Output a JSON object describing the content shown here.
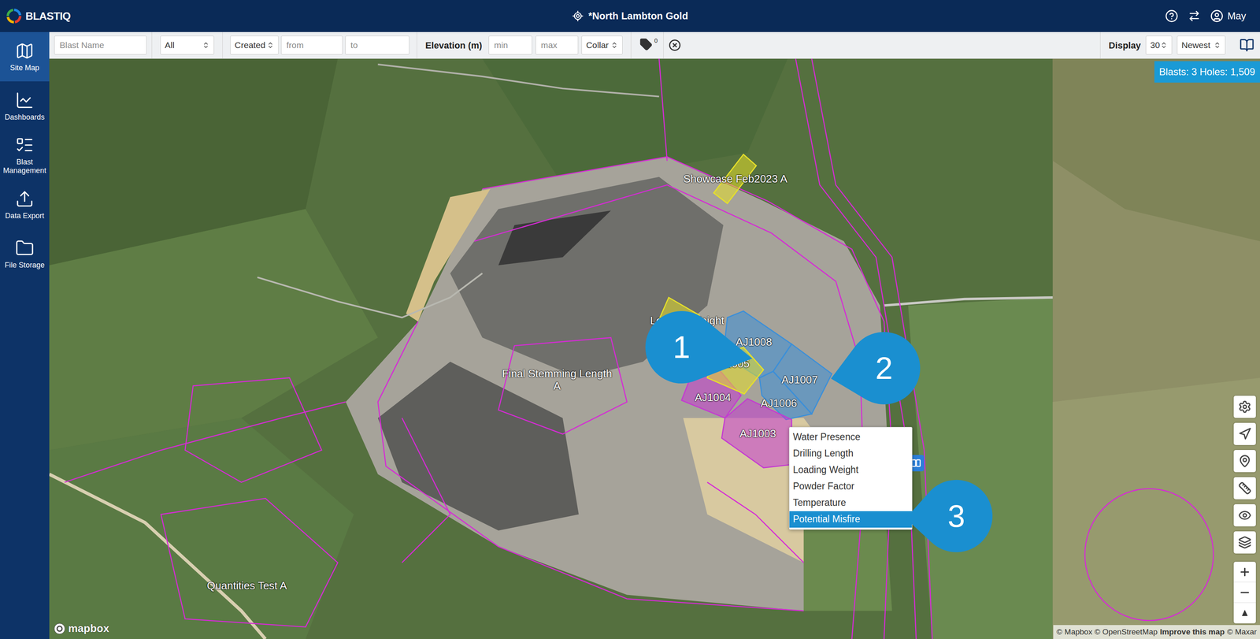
{
  "app": {
    "logo": "BLASTIQ",
    "site": "*North Lambton Gold",
    "user": "May"
  },
  "sidebar": {
    "items": [
      {
        "label": "Site Map",
        "selected": true
      },
      {
        "label": "Dashboards",
        "selected": false
      },
      {
        "label": "Blast Management",
        "selected": false
      },
      {
        "label": "Data Export",
        "selected": false
      },
      {
        "label": "File Storage",
        "selected": false
      }
    ]
  },
  "filters": {
    "blast_name": {
      "placeholder": "Blast Name"
    },
    "status": {
      "value": "All"
    },
    "date_field": {
      "value": "Created"
    },
    "from": {
      "placeholder": "from"
    },
    "to": {
      "placeholder": "to"
    },
    "elevation": {
      "label": "Elevation (m)",
      "min": {
        "placeholder": "min"
      },
      "max": {
        "placeholder": "max"
      },
      "reference": {
        "value": "Collar"
      }
    },
    "tags": {
      "count": "0"
    },
    "display": {
      "label": "Display",
      "count": "30",
      "sort": "Newest"
    }
  },
  "map": {
    "summary": "Blasts: 3 Holes: 1,509",
    "blasts": [
      {
        "label": "Showcase Feb2023 A",
        "color": "#e6e02a",
        "kind": "filled"
      },
      {
        "label": "Loading Weight",
        "color": "#e6e02a",
        "kind": "filled"
      },
      {
        "label": "AJ1008",
        "color": "#3b8fd9",
        "kind": "filled"
      },
      {
        "label": "AJ1005",
        "color": "#e6e02a",
        "kind": "filled"
      },
      {
        "label": "AJ1007",
        "color": "#3b8fd9",
        "kind": "filled"
      },
      {
        "label": "AJ1004",
        "color": "#c43bd1",
        "kind": "filled"
      },
      {
        "label": "AJ1006",
        "color": "#3b8fd9",
        "kind": "filled"
      },
      {
        "label": "AJ1003",
        "color": "#c43bd1",
        "kind": "filled"
      },
      {
        "label": "Final Stemming Length A",
        "color": "#d62ad6",
        "kind": "outline"
      },
      {
        "label": "Quantities Test A",
        "color": "#d62ad6",
        "kind": "outline"
      }
    ],
    "callouts": [
      {
        "label": "1"
      },
      {
        "label": "2"
      },
      {
        "label": "3"
      }
    ],
    "context_menu": {
      "items": [
        {
          "label": "Water Presence",
          "selected": false
        },
        {
          "label": "Drilling Length",
          "selected": false
        },
        {
          "label": "Loading Weight",
          "selected": false
        },
        {
          "label": "Powder Factor",
          "selected": false
        },
        {
          "label": "Temperature",
          "selected": false
        },
        {
          "label": "Potential Misfire",
          "selected": true
        }
      ]
    },
    "attribution": {
      "logo": "mapbox",
      "text": "© Mapbox © OpenStreetMap",
      "link": "Improve this map",
      "maxar": "© Maxar"
    }
  }
}
